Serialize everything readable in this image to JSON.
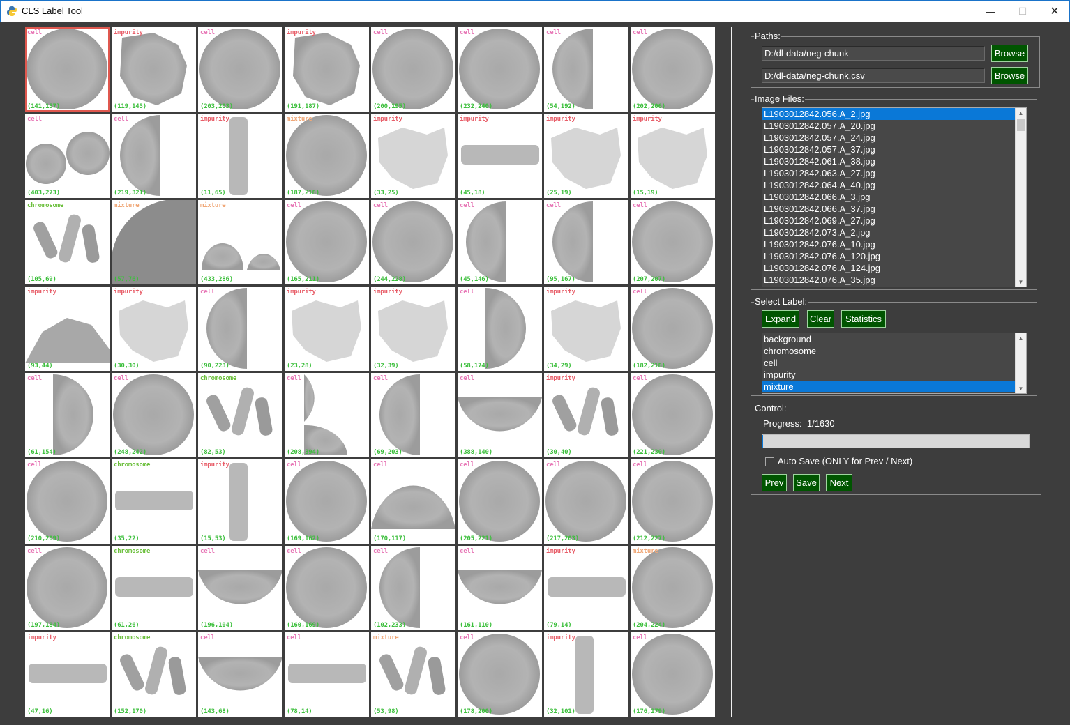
{
  "window": {
    "title": "CLS Label Tool",
    "minimize_glyph": "—",
    "maximize_glyph": "☐",
    "close_glyph": "✕"
  },
  "label_colors": {
    "cell": "#e87ab8",
    "impurity": "#e85f6a",
    "chromosome": "#6bbf3c",
    "mixture": "#f0a878",
    "background": "#aaaaaa"
  },
  "grid": {
    "tiles": [
      {
        "label": "cell",
        "coord": "(141,157)",
        "shape": "circle",
        "selected": true
      },
      {
        "label": "impurity",
        "coord": "(119,145)",
        "shape": "blob"
      },
      {
        "label": "cell",
        "coord": "(203,203)",
        "shape": "circle"
      },
      {
        "label": "impurity",
        "coord": "(191,187)",
        "shape": "blob"
      },
      {
        "label": "cell",
        "coord": "(200,195)",
        "shape": "circle"
      },
      {
        "label": "cell",
        "coord": "(232,240)",
        "shape": "circle"
      },
      {
        "label": "cell",
        "coord": "(54,192)",
        "shape": "half-left"
      },
      {
        "label": "cell",
        "coord": "(202,206)",
        "shape": "circle"
      },
      {
        "label": "cell",
        "coord": "(403,273)",
        "shape": "two"
      },
      {
        "label": "cell",
        "coord": "(219,321)",
        "shape": "half-left"
      },
      {
        "label": "impurity",
        "coord": "(11,65)",
        "shape": "strip-v"
      },
      {
        "label": "mixture",
        "coord": "(187,218)",
        "shape": "circle"
      },
      {
        "label": "impurity",
        "coord": "(33,25)",
        "shape": "blob-light"
      },
      {
        "label": "impurity",
        "coord": "(45,18)",
        "shape": "strip-h"
      },
      {
        "label": "impurity",
        "coord": "(25,19)",
        "shape": "blob-light"
      },
      {
        "label": "impurity",
        "coord": "(15,19)",
        "shape": "blob-light"
      },
      {
        "label": "chromosome",
        "coord": "(105,69)",
        "shape": "chromo"
      },
      {
        "label": "mixture",
        "coord": "(57,76)",
        "shape": "quarter"
      },
      {
        "label": "mixture",
        "coord": "(433,286)",
        "shape": "two-half"
      },
      {
        "label": "cell",
        "coord": "(165,211)",
        "shape": "circle"
      },
      {
        "label": "cell",
        "coord": "(244,228)",
        "shape": "circle"
      },
      {
        "label": "cell",
        "coord": "(45,146)",
        "shape": "half-left"
      },
      {
        "label": "cell",
        "coord": "(95,167)",
        "shape": "half-left"
      },
      {
        "label": "cell",
        "coord": "(207,207)",
        "shape": "circle"
      },
      {
        "label": "impurity",
        "coord": "(93,44)",
        "shape": "hill"
      },
      {
        "label": "impurity",
        "coord": "(30,30)",
        "shape": "blob-light"
      },
      {
        "label": "cell",
        "coord": "(90,223)",
        "shape": "half-left"
      },
      {
        "label": "impurity",
        "coord": "(23,28)",
        "shape": "blob-light"
      },
      {
        "label": "impurity",
        "coord": "(32,39)",
        "shape": "blob-light"
      },
      {
        "label": "cell",
        "coord": "(58,174)",
        "shape": "half-right"
      },
      {
        "label": "impurity",
        "coord": "(34,29)",
        "shape": "blob-light"
      },
      {
        "label": "cell",
        "coord": "(182,218)",
        "shape": "circle"
      },
      {
        "label": "cell",
        "coord": "(61,154)",
        "shape": "half-right"
      },
      {
        "label": "cell",
        "coord": "(248,242)",
        "shape": "circle"
      },
      {
        "label": "chromosome",
        "coord": "(82,53)",
        "shape": "chromo"
      },
      {
        "label": "cell",
        "coord": "(208,394)",
        "shape": "two-v"
      },
      {
        "label": "cell",
        "coord": "(69,203)",
        "shape": "half-left"
      },
      {
        "label": "cell",
        "coord": "(388,140)",
        "shape": "bowl"
      },
      {
        "label": "impurity",
        "coord": "(30,40)",
        "shape": "chromo"
      },
      {
        "label": "cell",
        "coord": "(221,230)",
        "shape": "circle"
      },
      {
        "label": "cell",
        "coord": "(210,209)",
        "shape": "circle"
      },
      {
        "label": "chromosome",
        "coord": "(35,22)",
        "shape": "strip-h"
      },
      {
        "label": "impurity",
        "coord": "(15,53)",
        "shape": "strip-v"
      },
      {
        "label": "cell",
        "coord": "(169,162)",
        "shape": "circle"
      },
      {
        "label": "cell",
        "coord": "(170,117)",
        "shape": "dome"
      },
      {
        "label": "cell",
        "coord": "(205,221)",
        "shape": "circle"
      },
      {
        "label": "cell",
        "coord": "(217,203)",
        "shape": "circle"
      },
      {
        "label": "cell",
        "coord": "(212,227)",
        "shape": "circle"
      },
      {
        "label": "cell",
        "coord": "(197,184)",
        "shape": "circle"
      },
      {
        "label": "chromosome",
        "coord": "(61,26)",
        "shape": "strip-h"
      },
      {
        "label": "cell",
        "coord": "(196,104)",
        "shape": "bowl"
      },
      {
        "label": "cell",
        "coord": "(160,169)",
        "shape": "circle"
      },
      {
        "label": "cell",
        "coord": "(102,233)",
        "shape": "half-left"
      },
      {
        "label": "cell",
        "coord": "(161,110)",
        "shape": "bowl"
      },
      {
        "label": "impurity",
        "coord": "(79,14)",
        "shape": "strip-h"
      },
      {
        "label": "mixture",
        "coord": "(204,224)",
        "shape": "circle"
      },
      {
        "label": "impurity",
        "coord": "(47,16)",
        "shape": "strip-h"
      },
      {
        "label": "chromosome",
        "coord": "(152,170)",
        "shape": "chromo"
      },
      {
        "label": "cell",
        "coord": "(143,68)",
        "shape": "bowl"
      },
      {
        "label": "cell",
        "coord": "(78,14)",
        "shape": "strip-h"
      },
      {
        "label": "mixture",
        "coord": "(53,98)",
        "shape": "chromo"
      },
      {
        "label": "cell",
        "coord": "(178,200)",
        "shape": "circle"
      },
      {
        "label": "impurity",
        "coord": "(32,101)",
        "shape": "strip-v"
      },
      {
        "label": "cell",
        "coord": "(176,179)",
        "shape": "circle"
      }
    ]
  },
  "paths": {
    "title": "Paths:",
    "image_dir": "D:/dl-data/neg-chunk",
    "csv_path": "D:/dl-data/neg-chunk.csv",
    "browse_label": "Browse"
  },
  "image_files": {
    "title": "Image Files:",
    "items": [
      "L1903012842.056.A_2.jpg",
      "L1903012842.057.A_20.jpg",
      "L1903012842.057.A_24.jpg",
      "L1903012842.057.A_37.jpg",
      "L1903012842.061.A_38.jpg",
      "L1903012842.063.A_27.jpg",
      "L1903012842.064.A_40.jpg",
      "L1903012842.066.A_3.jpg",
      "L1903012842.066.A_37.jpg",
      "L1903012842.069.A_27.jpg",
      "L1903012842.073.A_2.jpg",
      "L1903012842.076.A_10.jpg",
      "L1903012842.076.A_120.jpg",
      "L1903012842.076.A_124.jpg",
      "L1903012842.076.A_35.jpg"
    ],
    "selected_index": 0
  },
  "select_label": {
    "title": "Select Label:",
    "expand_label": "Expand",
    "clear_label": "Clear",
    "statistics_label": "Statistics",
    "items": [
      "background",
      "chromosome",
      "cell",
      "impurity",
      "mixture"
    ],
    "selected_index": 4
  },
  "control": {
    "title": "Control:",
    "progress_text": "Progress:  1/1630",
    "progress_fraction": 0.0006,
    "autosave_label": "Auto Save (ONLY for Prev / Next)",
    "autosave_checked": false,
    "prev_label": "Prev",
    "save_label": "Save",
    "next_label": "Next"
  }
}
